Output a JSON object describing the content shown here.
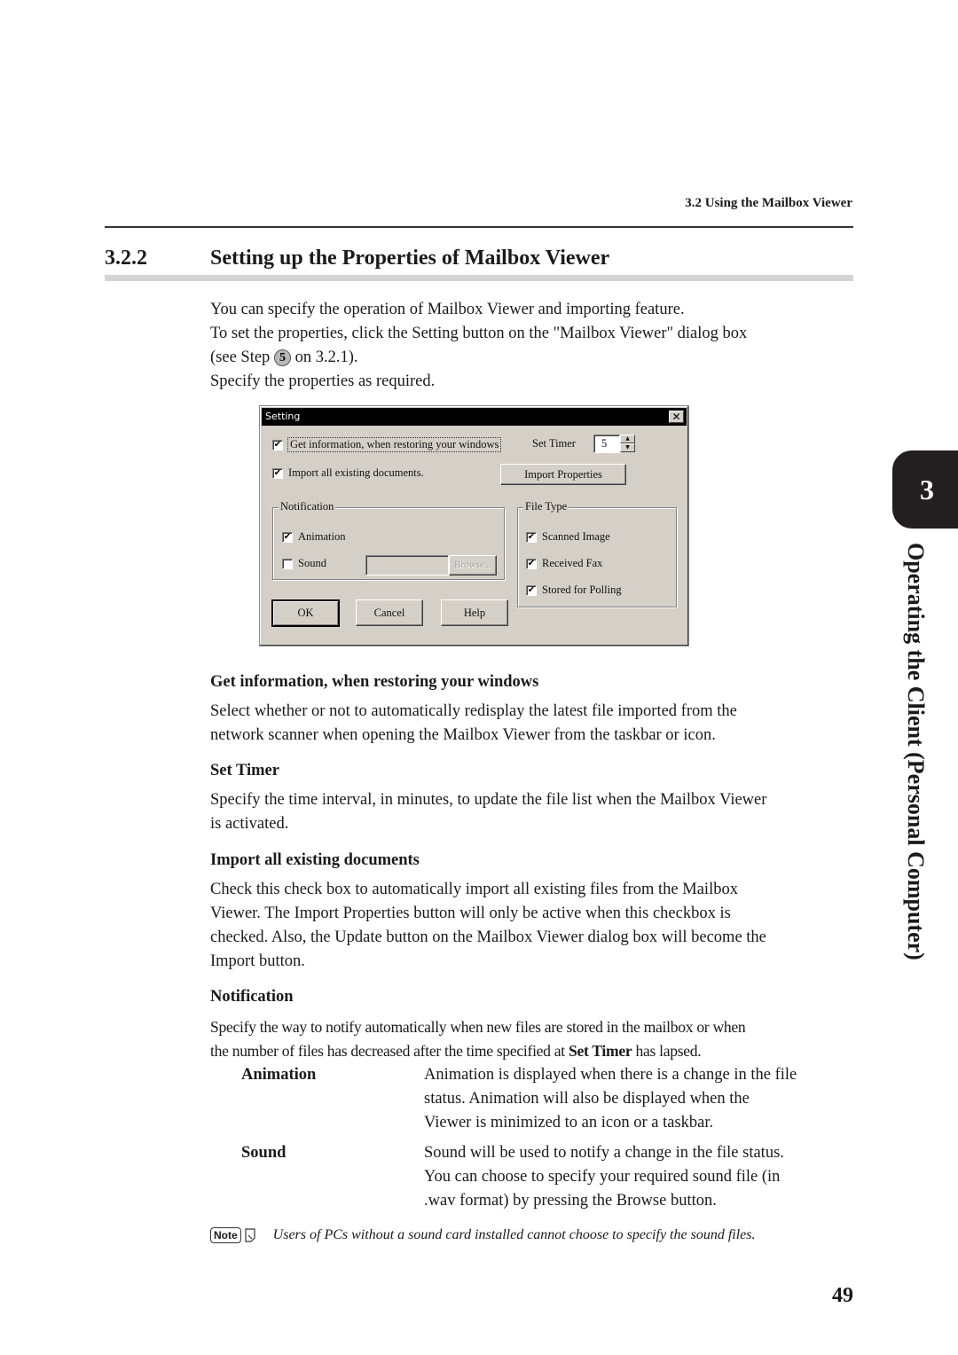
{
  "running_head": "3.2  Using the Mailbox Viewer",
  "section": {
    "number": "3.2.2",
    "title": "Setting up the Properties of Mailbox Viewer"
  },
  "intro": {
    "line1": "You can specify the operation of Mailbox Viewer and importing feature.",
    "line2": "To set the properties, click the Setting button on the \"Mailbox Viewer\" dialog box",
    "line3_before": "(see Step ",
    "step_number": "5",
    "line3_after": " on 3.2.1).",
    "line4": "Specify the properties as required."
  },
  "dialog": {
    "title": "Setting",
    "close_glyph": "✕",
    "get_info_label": "Get information, when restoring your windows",
    "get_info_checked": true,
    "set_timer_label": "Set Timer",
    "set_timer_value": "5",
    "spin_up_glyph": "▲",
    "spin_down_glyph": "▼",
    "import_all_label": "Import all existing documents.",
    "import_all_checked": true,
    "import_properties_button": "Import Properties",
    "notification": {
      "legend": "Notification",
      "animation_label": "Animation",
      "animation_checked": true,
      "sound_label": "Sound",
      "sound_checked": false,
      "sound_file_value": "",
      "browse_button": "Browse..."
    },
    "file_type": {
      "legend": "File Type",
      "scanned_image_label": "Scanned Image",
      "scanned_image_checked": true,
      "received_fax_label": "Received Fax",
      "received_fax_checked": true,
      "stored_polling_label": "Stored for Polling",
      "stored_polling_checked": true
    },
    "ok_button": "OK",
    "cancel_button": "Cancel",
    "help_button": "Help",
    "check_glyph": "✔"
  },
  "descriptions": {
    "get_info": {
      "heading": "Get information, when restoring your windows",
      "line1": "Select whether or not to automatically redisplay the latest file imported from the",
      "line2": "network scanner when opening the Mailbox Viewer from the taskbar or icon."
    },
    "set_timer": {
      "heading": "Set Timer",
      "line1": "Specify the time interval, in minutes, to update the file list when the Mailbox Viewer",
      "line2": "is activated."
    },
    "import_all": {
      "heading": "Import all existing documents",
      "line1": "Check this check box to automatically import all existing files from the Mailbox",
      "line2": "Viewer. The Import Properties button will only be active when this checkbox is",
      "line3": "checked. Also, the Update button on the Mailbox Viewer dialog box will become the",
      "line4": "Import button."
    },
    "notification": {
      "heading": "Notification",
      "line1": "Specify the way to notify automatically when new files are stored in the mailbox or when",
      "line2_before": "the number of files has decreased after the time specified at ",
      "line2_bold": "Set Timer",
      "line2_after": " has lapsed.",
      "items": [
        {
          "term": "Animation",
          "lines": [
            "Animation is displayed when there is a change in the file",
            "status. Animation will also be displayed when the",
            "Viewer is minimized to an icon or a taskbar."
          ]
        },
        {
          "term": "Sound",
          "lines": [
            "Sound will be used to notify a change in the file status.",
            "You can choose to specify your required sound file (in",
            ".wav format) by pressing the Browse button."
          ]
        }
      ]
    }
  },
  "note": {
    "badge": "Note",
    "text": "Users of PCs without a sound card installed cannot choose to specify the sound files."
  },
  "chapter": {
    "number": "3",
    "label": "Operating the Client (Personal Computer)"
  },
  "page_number": "49"
}
